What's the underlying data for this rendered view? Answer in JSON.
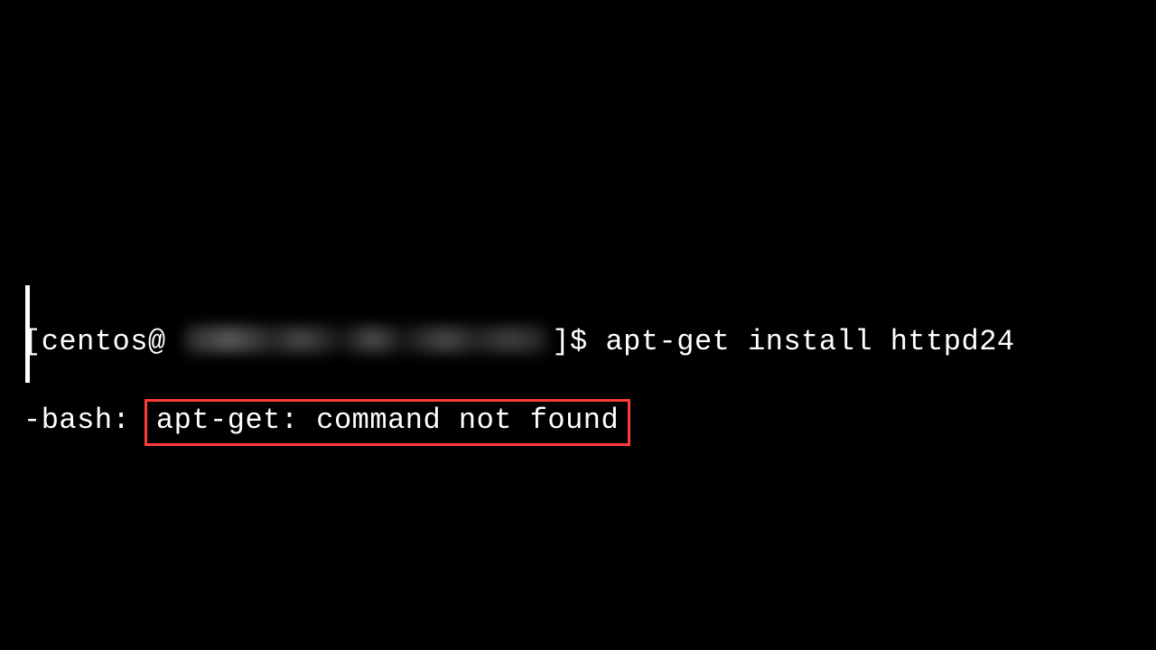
{
  "terminal": {
    "prompt_open": "[centos@",
    "prompt_close": "]$",
    "command": "apt-get install httpd24",
    "error_prefix": "-bash: ",
    "error_message": "apt-get: command not found"
  }
}
